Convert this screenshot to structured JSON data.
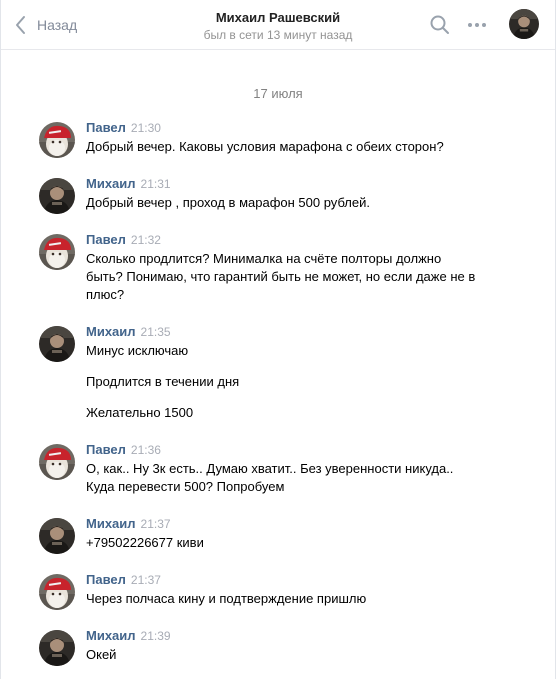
{
  "header": {
    "back_label": "Назад",
    "name": "Михаил Рашевский",
    "status": "был в сети 13 минут назад",
    "icons": [
      "chevron-left-icon",
      "search-icon",
      "more-icon"
    ]
  },
  "date_label": "17 июля",
  "colors": {
    "author": "#42648b",
    "time": "#a8acb5",
    "muted": "#828a99",
    "avatar_pavel": "#c8232c",
    "avatar_mikhail": "#3a3530"
  },
  "messages": [
    {
      "author": "Павел",
      "time": "21:30",
      "lines": [
        "Добрый вечер. Каковы условия марафона с обеих сторон?"
      ]
    },
    {
      "author": "Михаил",
      "time": "21:31",
      "lines": [
        "Добрый вечер , проход в марафон 500 рублей."
      ]
    },
    {
      "author": "Павел",
      "time": "21:32",
      "lines": [
        "Сколько продлится? Минималка на счёте полторы должно быть? Понимаю, что гарантий быть не может, но если даже не в плюс?"
      ]
    },
    {
      "author": "Михаил",
      "time": "21:35",
      "lines": [
        "Минус исключаю",
        "Продлится в течении дня",
        "Желательно 1500"
      ]
    },
    {
      "author": "Павел",
      "time": "21:36",
      "lines": [
        "О, как.. Ну 3к есть.. Думаю хватит.. Без уверенности никуда.. Куда перевести 500? Попробуем"
      ]
    },
    {
      "author": "Михаил",
      "time": "21:37",
      "lines": [
        "+79502226677 киви"
      ]
    },
    {
      "author": "Павел",
      "time": "21:37",
      "lines": [
        "Через полчаса кину и подтверждение пришлю"
      ]
    },
    {
      "author": "Михаил",
      "time": "21:39",
      "lines": [
        "Окей"
      ]
    }
  ]
}
